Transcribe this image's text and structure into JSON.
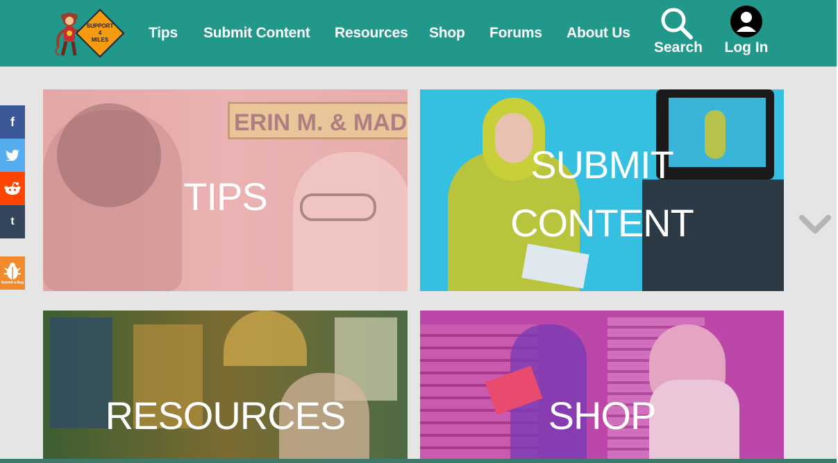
{
  "brand": {
    "logo_text_line1": "SUPPORT",
    "logo_text_line2": "4",
    "logo_text_line3": "MILES",
    "header_color": "#22988a"
  },
  "nav": {
    "items": [
      {
        "label": "Tips"
      },
      {
        "label": "Submit Content"
      },
      {
        "label": "Resources"
      },
      {
        "label": "Shop"
      },
      {
        "label": "Forums"
      },
      {
        "label": "About Us"
      }
    ],
    "search_label": "Search",
    "login_label": "Log In"
  },
  "social": {
    "items": [
      {
        "icon": "facebook-icon",
        "glyph": "f",
        "color": "#3b5998"
      },
      {
        "icon": "twitter-icon",
        "glyph": "",
        "color": "#55acee"
      },
      {
        "icon": "reddit-icon",
        "glyph": "",
        "color": "#ff4500"
      },
      {
        "icon": "tumblr-icon",
        "glyph": "t",
        "color": "#35465c"
      }
    ],
    "bug_report_label": "Submit a Bug",
    "bug_color": "#f28a2e"
  },
  "tiles": [
    {
      "caption_lines": [
        "TIPS"
      ],
      "sign_text": "ERIN M. & MAD",
      "overlay": "#e8a9a9"
    },
    {
      "caption_lines": [
        "SUBMIT",
        "CONTENT"
      ],
      "overlay": "#33bfe0"
    },
    {
      "caption_lines": [
        "RESOURCES"
      ],
      "overlay": "#4f6f3a"
    },
    {
      "caption_lines": [
        "SHOP"
      ],
      "overlay": "#b847a6"
    }
  ]
}
